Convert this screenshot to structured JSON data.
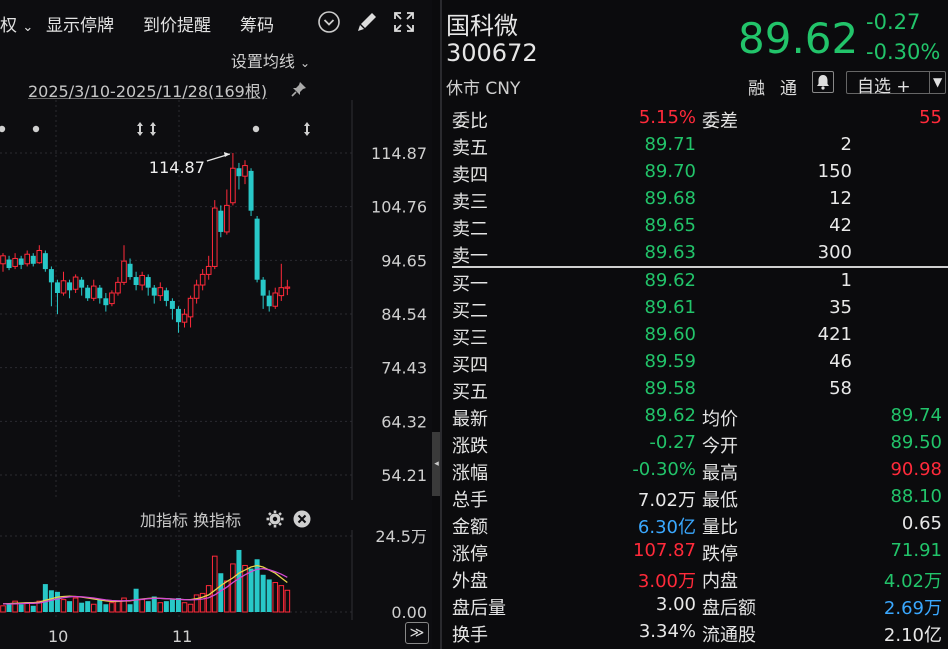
{
  "toolbar": {
    "rights_label": "权",
    "rights_dropdown": "⌄",
    "show_suspended": "显示停牌",
    "price_alert": "到价提醒",
    "chips": "筹码"
  },
  "chart": {
    "ma_settings": "设置均线",
    "ma_settings_caret": "⌄",
    "date_range": "2025/3/10-2025/11/28(169根)",
    "max_annotation": "114.87",
    "indicator_add": "加指标",
    "indicator_switch": "换指标",
    "x_labels": [
      "10",
      "11"
    ],
    "expand_glyph": "≫"
  },
  "chart_data": [
    {
      "type": "candlestick",
      "title": "",
      "y_ticks": [
        "114.87",
        "104.76",
        "94.65",
        "84.54",
        "74.43",
        "64.32",
        "54.21"
      ],
      "ylim": [
        54.21,
        114.87
      ],
      "grid": true,
      "high_marker": 114.87,
      "candles": [
        {
          "o": 94.0,
          "c": 95.5,
          "h": 96.0,
          "l": 92.5
        },
        {
          "o": 94.8,
          "c": 93.2,
          "h": 95.5,
          "l": 92.8
        },
        {
          "o": 93.5,
          "c": 95.0,
          "h": 96.0,
          "l": 93.0
        },
        {
          "o": 95.0,
          "c": 93.8,
          "h": 95.5,
          "l": 93.0
        },
        {
          "o": 94.0,
          "c": 95.8,
          "h": 96.5,
          "l": 93.5
        },
        {
          "o": 95.5,
          "c": 94.0,
          "h": 96.0,
          "l": 93.5
        },
        {
          "o": 94.2,
          "c": 96.5,
          "h": 97.5,
          "l": 94.0
        },
        {
          "o": 96.0,
          "c": 93.0,
          "h": 96.5,
          "l": 92.5
        },
        {
          "o": 93.0,
          "c": 90.5,
          "h": 93.5,
          "l": 86.0
        },
        {
          "o": 90.5,
          "c": 88.5,
          "h": 91.0,
          "l": 84.5
        },
        {
          "o": 88.5,
          "c": 90.8,
          "h": 92.5,
          "l": 88.0
        },
        {
          "o": 90.5,
          "c": 89.0,
          "h": 91.0,
          "l": 87.5
        },
        {
          "o": 89.2,
          "c": 91.5,
          "h": 92.0,
          "l": 88.5
        },
        {
          "o": 91.0,
          "c": 89.5,
          "h": 91.5,
          "l": 88.0
        },
        {
          "o": 89.5,
          "c": 87.5,
          "h": 90.0,
          "l": 87.0
        },
        {
          "o": 87.5,
          "c": 89.8,
          "h": 91.0,
          "l": 87.0
        },
        {
          "o": 89.5,
          "c": 87.5,
          "h": 90.0,
          "l": 86.5
        },
        {
          "o": 87.5,
          "c": 86.2,
          "h": 88.5,
          "l": 85.0
        },
        {
          "o": 86.5,
          "c": 88.5,
          "h": 89.0,
          "l": 86.0
        },
        {
          "o": 88.5,
          "c": 90.5,
          "h": 91.5,
          "l": 88.0
        },
        {
          "o": 90.5,
          "c": 94.5,
          "h": 97.5,
          "l": 90.0
        },
        {
          "o": 94.0,
          "c": 91.5,
          "h": 95.0,
          "l": 91.0
        },
        {
          "o": 91.5,
          "c": 90.0,
          "h": 92.5,
          "l": 89.0
        },
        {
          "o": 90.0,
          "c": 91.8,
          "h": 92.5,
          "l": 89.0
        },
        {
          "o": 91.5,
          "c": 89.5,
          "h": 92.0,
          "l": 88.0
        },
        {
          "o": 89.5,
          "c": 88.0,
          "h": 90.0,
          "l": 86.5
        },
        {
          "o": 88.0,
          "c": 89.5,
          "h": 90.5,
          "l": 87.0
        },
        {
          "o": 89.0,
          "c": 87.0,
          "h": 89.5,
          "l": 86.0
        },
        {
          "o": 87.0,
          "c": 85.5,
          "h": 87.5,
          "l": 83.5
        },
        {
          "o": 85.5,
          "c": 83.0,
          "h": 86.0,
          "l": 81.0
        },
        {
          "o": 83.0,
          "c": 84.5,
          "h": 85.5,
          "l": 82.0
        },
        {
          "o": 84.0,
          "c": 87.5,
          "h": 88.0,
          "l": 82.0
        },
        {
          "o": 87.5,
          "c": 90.0,
          "h": 91.0,
          "l": 86.5
        },
        {
          "o": 90.0,
          "c": 92.0,
          "h": 93.0,
          "l": 89.0
        },
        {
          "o": 92.0,
          "c": 93.5,
          "h": 95.5,
          "l": 91.0
        },
        {
          "o": 93.5,
          "c": 104.5,
          "h": 106.0,
          "l": 93.0
        },
        {
          "o": 104.0,
          "c": 100.0,
          "h": 105.0,
          "l": 99.0
        },
        {
          "o": 100.0,
          "c": 105.0,
          "h": 108.0,
          "l": 99.5
        },
        {
          "o": 105.5,
          "c": 112.0,
          "h": 114.87,
          "l": 105.0
        },
        {
          "o": 112.0,
          "c": 110.5,
          "h": 113.0,
          "l": 108.0
        },
        {
          "o": 110.5,
          "c": 112.5,
          "h": 113.5,
          "l": 109.0
        },
        {
          "o": 111.5,
          "c": 104.0,
          "h": 112.0,
          "l": 103.0
        },
        {
          "o": 102.5,
          "c": 91.0,
          "h": 103.0,
          "l": 90.5
        },
        {
          "o": 91.0,
          "c": 88.0,
          "h": 91.5,
          "l": 85.5
        },
        {
          "o": 88.0,
          "c": 86.0,
          "h": 89.0,
          "l": 85.0
        },
        {
          "o": 86.0,
          "c": 88.5,
          "h": 89.5,
          "l": 85.5
        },
        {
          "o": 88.0,
          "c": 89.5,
          "h": 94.0,
          "l": 87.0
        },
        {
          "o": 89.5,
          "c": 89.62,
          "h": 90.98,
          "l": 88.1
        }
      ]
    },
    {
      "type": "bar",
      "title": "",
      "y_ticks": [
        "24.5万",
        "0.00"
      ],
      "ylim": [
        0,
        24.5
      ],
      "values": [
        2.0,
        2.5,
        3.5,
        2.5,
        3.0,
        2.0,
        3.5,
        9.0,
        7.0,
        6.5,
        4.0,
        3.5,
        4.5,
        3.0,
        3.5,
        2.5,
        4.0,
        2.5,
        3.0,
        3.5,
        4.5,
        2.5,
        7.5,
        4.0,
        3.5,
        5.0,
        3.0,
        3.5,
        4.0,
        4.5,
        3.0,
        2.5,
        5.5,
        6.0,
        8.5,
        18.0,
        12.5,
        10.0,
        15.5,
        20.0,
        15.0,
        14.0,
        17.0,
        12.0,
        10.5,
        9.5,
        8.5,
        7.0
      ],
      "up": [
        true,
        false,
        true,
        false,
        true,
        false,
        true,
        false,
        false,
        false,
        true,
        false,
        true,
        false,
        false,
        true,
        false,
        false,
        true,
        true,
        true,
        false,
        false,
        true,
        false,
        false,
        true,
        false,
        false,
        false,
        true,
        true,
        true,
        true,
        true,
        true,
        false,
        true,
        true,
        false,
        true,
        false,
        false,
        false,
        false,
        true,
        true,
        true
      ],
      "ma_series": [
        {
          "color": "#e8d44a",
          "values": [
            2.6,
            2.7,
            2.8,
            2.9,
            3.0,
            3.0,
            3.2,
            3.8,
            4.3,
            4.8,
            5.0,
            5.1,
            5.0,
            4.8,
            4.5,
            4.2,
            3.9,
            3.6,
            3.4,
            3.4,
            3.5,
            3.6,
            3.9,
            4.2,
            4.4,
            4.5,
            4.4,
            4.3,
            4.2,
            4.1,
            4.0,
            4.0,
            4.3,
            4.8,
            5.5,
            7.0,
            8.5,
            9.8,
            11.0,
            12.5,
            13.5,
            14.5,
            15.0,
            14.5,
            13.5,
            12.5,
            11.0,
            9.5
          ]
        },
        {
          "color": "#d44ad4",
          "values": [
            2.6,
            2.6,
            2.6,
            2.7,
            2.8,
            2.8,
            2.9,
            3.3,
            3.8,
            4.2,
            4.6,
            4.9,
            5.0,
            4.9,
            4.7,
            4.5,
            4.2,
            3.9,
            3.7,
            3.6,
            3.6,
            3.7,
            3.9,
            4.1,
            4.3,
            4.4,
            4.4,
            4.3,
            4.2,
            4.1,
            4.0,
            3.9,
            4.0,
            4.2,
            4.6,
            5.5,
            6.8,
            8.0,
            9.5,
            10.8,
            12.0,
            13.0,
            13.8,
            14.0,
            13.6,
            13.0,
            12.2,
            11.2
          ]
        }
      ]
    }
  ],
  "stock": {
    "name": "国科微",
    "code": "300672",
    "status": "休市 CNY",
    "price": "89.62",
    "change": "-0.27",
    "change_pct": "-0.30%",
    "margin_tag": "融",
    "connect_tag": "通",
    "watchlist_label": "自选 +",
    "watchlist_caret": "▼"
  },
  "quote": {
    "commit_ratio_label": "委比",
    "commit_ratio": "5.15%",
    "commit_diff_label": "委差",
    "commit_diff": "55",
    "asks": [
      {
        "label": "卖五",
        "price": "89.71",
        "vol": "2"
      },
      {
        "label": "卖四",
        "price": "89.70",
        "vol": "150"
      },
      {
        "label": "卖三",
        "price": "89.68",
        "vol": "12"
      },
      {
        "label": "卖二",
        "price": "89.65",
        "vol": "42"
      },
      {
        "label": "卖一",
        "price": "89.63",
        "vol": "300"
      }
    ],
    "bids": [
      {
        "label": "买一",
        "price": "89.62",
        "vol": "1"
      },
      {
        "label": "买二",
        "price": "89.61",
        "vol": "35"
      },
      {
        "label": "买三",
        "price": "89.60",
        "vol": "421"
      },
      {
        "label": "买四",
        "price": "89.59",
        "vol": "46"
      },
      {
        "label": "买五",
        "price": "89.58",
        "vol": "58"
      }
    ],
    "stats": [
      {
        "l1": "最新",
        "v1": "89.62",
        "c1": "green",
        "l2": "均价",
        "v2": "89.74",
        "c2": "green"
      },
      {
        "l1": "涨跌",
        "v1": "-0.27",
        "c1": "green",
        "l2": "今开",
        "v2": "89.50",
        "c2": "green"
      },
      {
        "l1": "涨幅",
        "v1": "-0.30%",
        "c1": "green",
        "l2": "最高",
        "v2": "90.98",
        "c2": "red"
      },
      {
        "l1": "总手",
        "v1": "7.02万",
        "c1": "white",
        "l2": "最低",
        "v2": "88.10",
        "c2": "green"
      },
      {
        "l1": "金额",
        "v1": "6.30亿",
        "c1": "cyan",
        "l2": "量比",
        "v2": "0.65",
        "c2": "white"
      },
      {
        "l1": "涨停",
        "v1": "107.87",
        "c1": "red",
        "l2": "跌停",
        "v2": "71.91",
        "c2": "green"
      },
      {
        "l1": "外盘",
        "v1": "3.00万",
        "c1": "red",
        "l2": "内盘",
        "v2": "4.02万",
        "c2": "green"
      },
      {
        "l1": "盘后量",
        "v1": "3.00",
        "c1": "white",
        "l2": "盘后额",
        "v2": "2.69万",
        "c2": "cyan"
      },
      {
        "l1": "换手",
        "v1": "3.34%",
        "c1": "white",
        "l2": "流通股",
        "v2": "2.10亿",
        "c2": "white"
      }
    ]
  },
  "colors": {
    "up": "#ff2a3a",
    "down": "#28c8c8",
    "green": "#22c46a",
    "cyan": "#3aa8ff",
    "grid": "#2a2a30"
  }
}
